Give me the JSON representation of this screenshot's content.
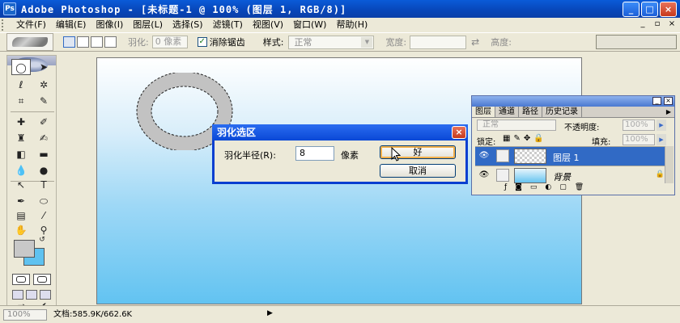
{
  "window": {
    "title": "Adobe Photoshop - [未标题-1 @ 100% (图层 1, RGB/8)]",
    "buttons": {
      "minimize": "_",
      "maximize": "□",
      "close": "×"
    }
  },
  "menu": {
    "items": [
      "文件(F)",
      "编辑(E)",
      "图像(I)",
      "图层(L)",
      "选择(S)",
      "滤镜(T)",
      "视图(V)",
      "窗口(W)",
      "帮助(H)"
    ],
    "doc_buttons": [
      "_",
      "▫",
      "×"
    ]
  },
  "options": {
    "feather_label": "羽化:",
    "feather_value": "0 像素",
    "antialias_label": "消除锯齿",
    "antialias_checked": true,
    "style_label": "样式:",
    "style_value": "正常",
    "width_label": "宽度:",
    "height_label": "高度:",
    "swap_icon": "⇄"
  },
  "toolbox": {
    "foreground_color": "#c8c8c8",
    "background_color": "#5fc2f0"
  },
  "dialog": {
    "title": "羽化选区",
    "radius_label": "羽化半径(R):",
    "radius_value": "8",
    "unit": "像素",
    "ok_label": "好",
    "cancel_label": "取消",
    "close": "×"
  },
  "layers_panel": {
    "tabs": [
      "图层",
      "通道",
      "路径",
      "历史记录"
    ],
    "blend_mode": "正常",
    "opacity_label": "不透明度:",
    "opacity_value": "100%",
    "lock_label": "锁定:",
    "fill_label": "填充:",
    "fill_value": "100%",
    "layers": [
      {
        "name": "图层 1",
        "selected": true
      },
      {
        "name": "背景",
        "selected": false,
        "locked": true
      }
    ]
  },
  "status": {
    "zoom": "100%",
    "doc_info": "文档:585.9K/662.6K",
    "arrow": "▶"
  }
}
